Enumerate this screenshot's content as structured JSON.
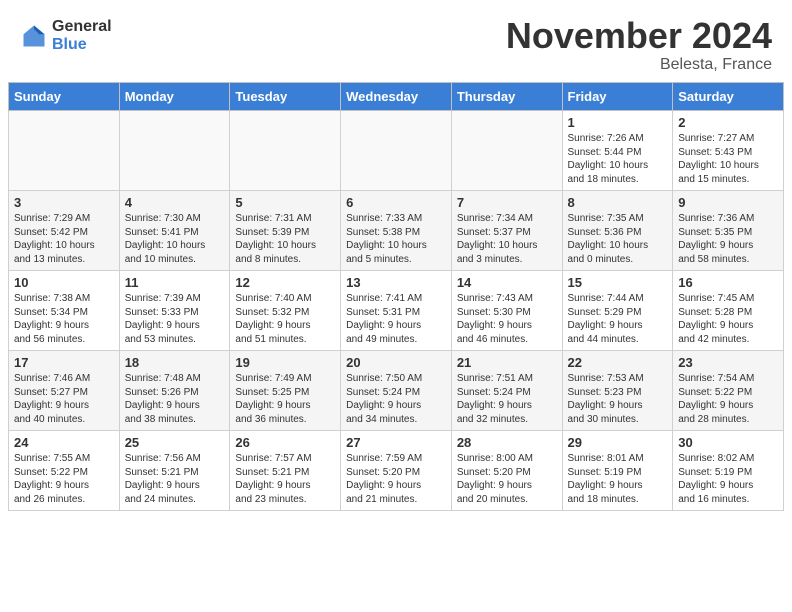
{
  "header": {
    "logo_general": "General",
    "logo_blue": "Blue",
    "month_title": "November 2024",
    "location": "Belesta, France"
  },
  "weekdays": [
    "Sunday",
    "Monday",
    "Tuesday",
    "Wednesday",
    "Thursday",
    "Friday",
    "Saturday"
  ],
  "weeks": [
    [
      {
        "day": "",
        "info": ""
      },
      {
        "day": "",
        "info": ""
      },
      {
        "day": "",
        "info": ""
      },
      {
        "day": "",
        "info": ""
      },
      {
        "day": "",
        "info": ""
      },
      {
        "day": "1",
        "info": "Sunrise: 7:26 AM\nSunset: 5:44 PM\nDaylight: 10 hours\nand 18 minutes."
      },
      {
        "day": "2",
        "info": "Sunrise: 7:27 AM\nSunset: 5:43 PM\nDaylight: 10 hours\nand 15 minutes."
      }
    ],
    [
      {
        "day": "3",
        "info": "Sunrise: 7:29 AM\nSunset: 5:42 PM\nDaylight: 10 hours\nand 13 minutes."
      },
      {
        "day": "4",
        "info": "Sunrise: 7:30 AM\nSunset: 5:41 PM\nDaylight: 10 hours\nand 10 minutes."
      },
      {
        "day": "5",
        "info": "Sunrise: 7:31 AM\nSunset: 5:39 PM\nDaylight: 10 hours\nand 8 minutes."
      },
      {
        "day": "6",
        "info": "Sunrise: 7:33 AM\nSunset: 5:38 PM\nDaylight: 10 hours\nand 5 minutes."
      },
      {
        "day": "7",
        "info": "Sunrise: 7:34 AM\nSunset: 5:37 PM\nDaylight: 10 hours\nand 3 minutes."
      },
      {
        "day": "8",
        "info": "Sunrise: 7:35 AM\nSunset: 5:36 PM\nDaylight: 10 hours\nand 0 minutes."
      },
      {
        "day": "9",
        "info": "Sunrise: 7:36 AM\nSunset: 5:35 PM\nDaylight: 9 hours\nand 58 minutes."
      }
    ],
    [
      {
        "day": "10",
        "info": "Sunrise: 7:38 AM\nSunset: 5:34 PM\nDaylight: 9 hours\nand 56 minutes."
      },
      {
        "day": "11",
        "info": "Sunrise: 7:39 AM\nSunset: 5:33 PM\nDaylight: 9 hours\nand 53 minutes."
      },
      {
        "day": "12",
        "info": "Sunrise: 7:40 AM\nSunset: 5:32 PM\nDaylight: 9 hours\nand 51 minutes."
      },
      {
        "day": "13",
        "info": "Sunrise: 7:41 AM\nSunset: 5:31 PM\nDaylight: 9 hours\nand 49 minutes."
      },
      {
        "day": "14",
        "info": "Sunrise: 7:43 AM\nSunset: 5:30 PM\nDaylight: 9 hours\nand 46 minutes."
      },
      {
        "day": "15",
        "info": "Sunrise: 7:44 AM\nSunset: 5:29 PM\nDaylight: 9 hours\nand 44 minutes."
      },
      {
        "day": "16",
        "info": "Sunrise: 7:45 AM\nSunset: 5:28 PM\nDaylight: 9 hours\nand 42 minutes."
      }
    ],
    [
      {
        "day": "17",
        "info": "Sunrise: 7:46 AM\nSunset: 5:27 PM\nDaylight: 9 hours\nand 40 minutes."
      },
      {
        "day": "18",
        "info": "Sunrise: 7:48 AM\nSunset: 5:26 PM\nDaylight: 9 hours\nand 38 minutes."
      },
      {
        "day": "19",
        "info": "Sunrise: 7:49 AM\nSunset: 5:25 PM\nDaylight: 9 hours\nand 36 minutes."
      },
      {
        "day": "20",
        "info": "Sunrise: 7:50 AM\nSunset: 5:24 PM\nDaylight: 9 hours\nand 34 minutes."
      },
      {
        "day": "21",
        "info": "Sunrise: 7:51 AM\nSunset: 5:24 PM\nDaylight: 9 hours\nand 32 minutes."
      },
      {
        "day": "22",
        "info": "Sunrise: 7:53 AM\nSunset: 5:23 PM\nDaylight: 9 hours\nand 30 minutes."
      },
      {
        "day": "23",
        "info": "Sunrise: 7:54 AM\nSunset: 5:22 PM\nDaylight: 9 hours\nand 28 minutes."
      }
    ],
    [
      {
        "day": "24",
        "info": "Sunrise: 7:55 AM\nSunset: 5:22 PM\nDaylight: 9 hours\nand 26 minutes."
      },
      {
        "day": "25",
        "info": "Sunrise: 7:56 AM\nSunset: 5:21 PM\nDaylight: 9 hours\nand 24 minutes."
      },
      {
        "day": "26",
        "info": "Sunrise: 7:57 AM\nSunset: 5:21 PM\nDaylight: 9 hours\nand 23 minutes."
      },
      {
        "day": "27",
        "info": "Sunrise: 7:59 AM\nSunset: 5:20 PM\nDaylight: 9 hours\nand 21 minutes."
      },
      {
        "day": "28",
        "info": "Sunrise: 8:00 AM\nSunset: 5:20 PM\nDaylight: 9 hours\nand 20 minutes."
      },
      {
        "day": "29",
        "info": "Sunrise: 8:01 AM\nSunset: 5:19 PM\nDaylight: 9 hours\nand 18 minutes."
      },
      {
        "day": "30",
        "info": "Sunrise: 8:02 AM\nSunset: 5:19 PM\nDaylight: 9 hours\nand 16 minutes."
      }
    ]
  ]
}
